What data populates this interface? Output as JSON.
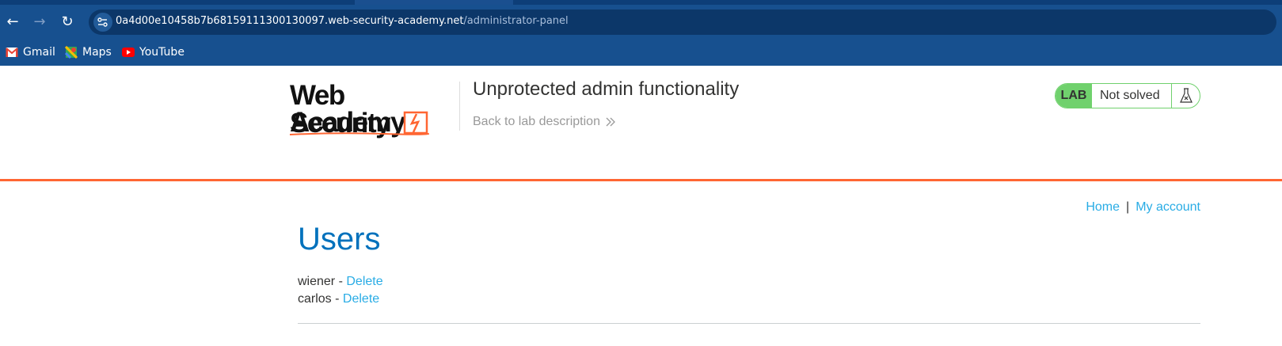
{
  "browser": {
    "url_host": "0a4d00e10458b7b68159111300130097.web-security-academy.net",
    "url_path": "/administrator-panel",
    "bookmarks": [
      {
        "label": "Gmail",
        "icon": "gmail-icon"
      },
      {
        "label": "Maps",
        "icon": "maps-icon"
      },
      {
        "label": "YouTube",
        "icon": "youtube-icon"
      }
    ]
  },
  "header": {
    "logo_line1": "Web Security",
    "logo_line2": "Academy",
    "lab_title": "Unprotected admin functionality",
    "back_link": "Back to lab description",
    "status_badge": "LAB",
    "status_text": "Not solved"
  },
  "nav": {
    "home": "Home",
    "separator": "|",
    "account": "My account"
  },
  "main": {
    "heading": "Users",
    "users": [
      {
        "name": "wiener",
        "action": "Delete"
      },
      {
        "name": "carlos",
        "action": "Delete"
      }
    ]
  },
  "colors": {
    "accent_orange": "#ff6633",
    "link_blue": "#29ace5",
    "heading_blue": "#0071bc",
    "lab_green": "#70d16d",
    "chrome_blue": "#17508f"
  }
}
